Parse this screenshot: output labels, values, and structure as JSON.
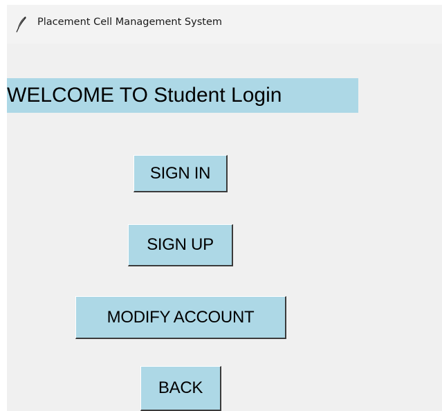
{
  "window": {
    "title": "Placement Cell Management System",
    "title_icon": "feather-icon"
  },
  "main": {
    "heading": "WELCOME TO Student Login",
    "buttons": {
      "sign_in": "SIGN IN",
      "sign_up": "SIGN UP",
      "modify_account": "MODIFY ACCOUNT",
      "back": "BACK"
    }
  },
  "colors": {
    "accent": "#add8e6",
    "window_background": "#f0f0f0",
    "titlebar_background": "#f3f3f3"
  }
}
